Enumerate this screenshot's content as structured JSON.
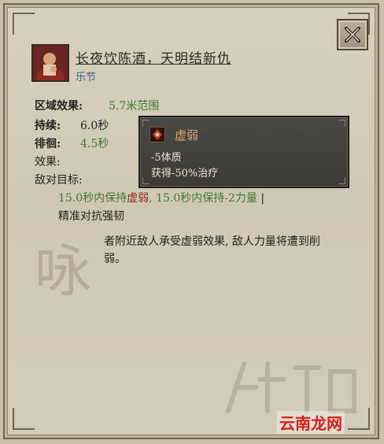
{
  "ability": {
    "title": "长夜饮陈酒，天明结新仇",
    "category": "乐节"
  },
  "stats": {
    "area_label": "区域效果:",
    "area_value": "5.7米范围",
    "duration_label": "持续:",
    "duration_value": "6.0秒",
    "linger_label": "徘徊:",
    "linger_value": "4.5秒",
    "effect_label": "效果:",
    "enemy_target_label": "敌对目标:"
  },
  "effects": {
    "part1": "15.0秒内保持",
    "part2": "虚弱",
    "part3": ", 15.0秒内保持-2力量",
    "separator": "|",
    "line2": "精准对抗强韧"
  },
  "flavor": {
    "big_char": "咏",
    "description": "者附近敌人承受虚弱效果, 敌人力量将遭到削弱。"
  },
  "tooltip": {
    "name": "虚弱",
    "line1": "-5体质",
    "line2": "获得-50%治疗"
  },
  "watermark": {
    "site": "云南龙网"
  },
  "colors": {
    "positive": "#3f7a36",
    "negative": "#8a2b24",
    "category": "#3f5a8a",
    "tooltip_title": "#d6a978"
  },
  "icons": {
    "close": "close-icon",
    "portrait": "singer-portrait",
    "tooltip": "weakened-icon"
  }
}
